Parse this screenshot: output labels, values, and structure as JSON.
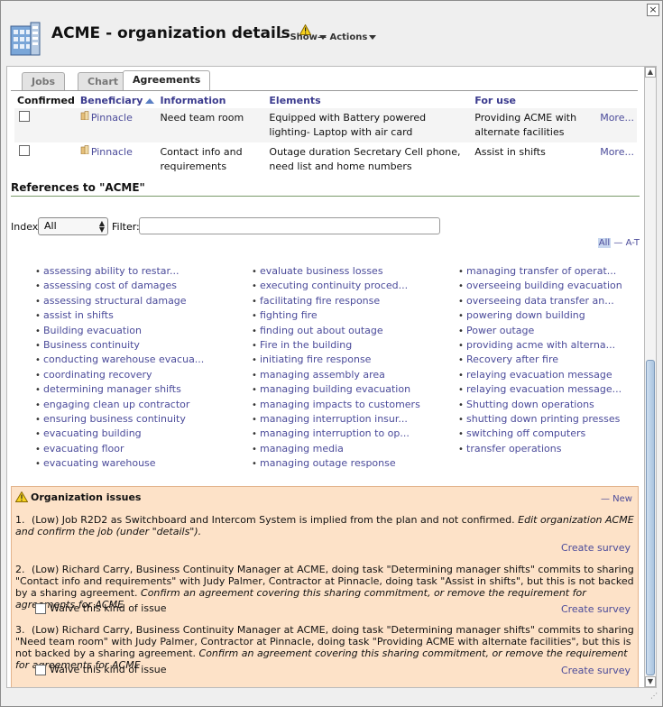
{
  "window": {
    "close_glyph": "×",
    "title": "ACME - organization details",
    "show_menu": "— Show",
    "actions_menu": "— Actions"
  },
  "tabs": [
    {
      "label": "Jobs",
      "active": false
    },
    {
      "label": "Chart",
      "active": false
    },
    {
      "label": "Agreements",
      "active": true
    }
  ],
  "agreements": {
    "headers": {
      "confirmed": "Confirmed",
      "beneficiary": "Beneficiary",
      "information": "Information",
      "elements": "Elements",
      "for_use": "For use"
    },
    "rows": [
      {
        "beneficiary": "Pinnacle",
        "information": "Need team room",
        "elements": "Equipped with Battery powered lighting- Laptop with air card",
        "for_use": "Providing ACME with alternate facilities",
        "more": "More..."
      },
      {
        "beneficiary": "Pinnacle",
        "information": "Contact info and requirements",
        "elements": "Outage duration Secretary Cell phone, need list and home numbers",
        "for_use": "Assist in shifts",
        "more": "More..."
      }
    ]
  },
  "references": {
    "title": "References to \"ACME\"",
    "index_label": "Index",
    "index_value": "All",
    "filter_label": "Filter:",
    "filter_value": "",
    "az_all": "All",
    "az_rest": "— A-T",
    "col1": [
      "assessing ability to restar...",
      "assessing cost of damages",
      "assessing structural damage",
      "assist in shifts",
      "Building evacuation",
      "Business continuity",
      "conducting warehouse evacua...",
      "coordinating recovery",
      "determining manager shifts",
      "engaging clean up contractor",
      "ensuring business continuity",
      "evacuating building",
      "evacuating floor",
      "evacuating warehouse"
    ],
    "col2": [
      "evaluate business losses",
      "executing continuity proced...",
      "facilitating fire response",
      "fighting fire",
      "finding out about outage",
      "Fire in the building",
      "initiating fire response",
      "managing assembly area",
      "managing building evacuation",
      "managing impacts to customers",
      "managing interruption insur...",
      "managing interruption to op...",
      "managing media",
      "managing outage response"
    ],
    "col3": [
      "managing transfer of operat...",
      "overseeing building evacuation",
      "overseeing data transfer an...",
      "powering down building",
      "Power outage",
      "providing acme with alterna...",
      "Recovery after fire",
      "relaying evacuation message",
      "relaying evacuation message...",
      "Shutting down operations",
      "shutting down printing presses",
      "switching off computers",
      "transfer operations"
    ]
  },
  "issues": {
    "title": "Organization issues",
    "new_label": "— New",
    "items": [
      {
        "num": "1.",
        "text": "(Low) Job R2D2 as Switchboard and Intercom System is implied from the plan and not confirmed.",
        "hint": "Edit organization ACME and confirm the job (under \"details\").",
        "survey": "Create survey"
      },
      {
        "num": "2.",
        "text": "(Low) Richard Carry, Business Continuity Manager at ACME, doing task \"Determining manager shifts\" commits to sharing \"Contact info and requirements\" with Judy Palmer, Contractor at Pinnacle, doing task \"Assist in shifts\", but this is not backed by a sharing agreement.",
        "hint": "Confirm an agreement covering this sharing commitment, or remove the requirement for agreements for ACME",
        "waive": "Waive this kind of issue",
        "survey": "Create survey"
      },
      {
        "num": "3.",
        "text": "(Low) Richard Carry, Business Continuity Manager at ACME, doing task \"Determining manager shifts\" commits to sharing \"Need team room\" with Judy Palmer, Contractor at Pinnacle, doing task \"Providing ACME with alternate facilities\", but this is not backed by a sharing agreement.",
        "hint": "Confirm an agreement covering this sharing commitment, or remove the requirement for agreements for ACME",
        "waive": "Waive this kind of issue",
        "survey": "Create survey"
      }
    ]
  },
  "colors": {
    "link": "#4b4b9a",
    "issues_bg": "#fde2c8",
    "scroll_thumb": "#a9c4e0"
  }
}
